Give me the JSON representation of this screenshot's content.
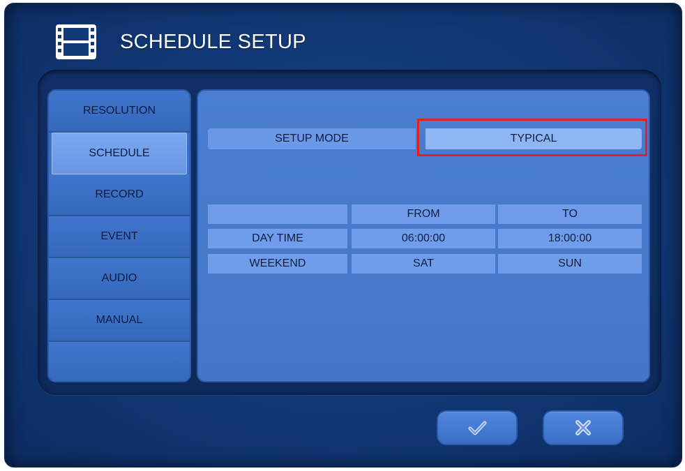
{
  "header": {
    "title": "SCHEDULE SETUP",
    "icon": "film-icon"
  },
  "sidebar": {
    "items": [
      {
        "label": "RESOLUTION"
      },
      {
        "label": "SCHEDULE",
        "active": true
      },
      {
        "label": "RECORD"
      },
      {
        "label": "EVENT"
      },
      {
        "label": "AUDIO"
      },
      {
        "label": "MANUAL"
      }
    ]
  },
  "setup_mode": {
    "label": "SETUP MODE",
    "value": "TYPICAL"
  },
  "schedule_table": {
    "headers": [
      "",
      "FROM",
      "TO"
    ],
    "rows": [
      {
        "label": "DAY TIME",
        "from": "06:00:00",
        "to": "18:00:00"
      },
      {
        "label": "WEEKEND",
        "from": "SAT",
        "to": "SUN"
      }
    ]
  },
  "buttons": {
    "confirm_icon": "checkmark-icon",
    "cancel_icon": "x-icon"
  },
  "colors": {
    "background": "#123a78",
    "panel": "#4575c6",
    "active_item": "#7ba8f0",
    "highlight": "#e0221c"
  }
}
